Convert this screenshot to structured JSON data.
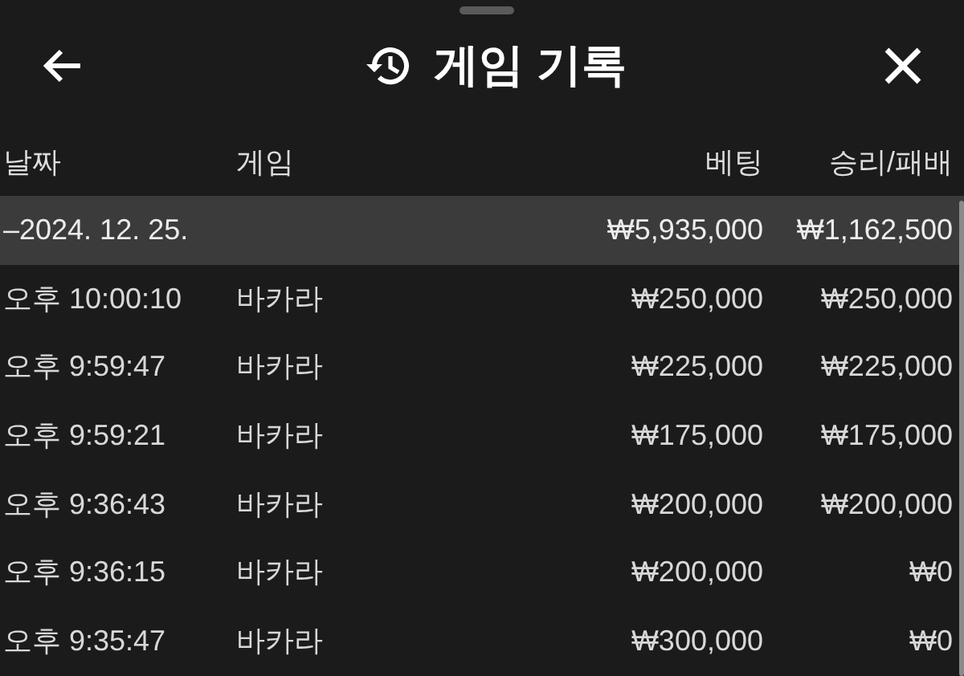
{
  "header": {
    "title": "게임 기록"
  },
  "table": {
    "columns": [
      "날짜",
      "게임",
      "베팅",
      "승리/패배"
    ],
    "group": {
      "date": "–2024. 12. 25.",
      "bet": "₩5,935,000",
      "result": "₩1,162,500"
    },
    "rows": [
      {
        "time": "오후 10:00:10",
        "game": "바카라",
        "bet": "₩250,000",
        "result": "₩250,000"
      },
      {
        "time": "오후 9:59:47",
        "game": "바카라",
        "bet": "₩225,000",
        "result": "₩225,000"
      },
      {
        "time": "오후 9:59:21",
        "game": "바카라",
        "bet": "₩175,000",
        "result": "₩175,000"
      },
      {
        "time": "오후 9:36:43",
        "game": "바카라",
        "bet": "₩200,000",
        "result": "₩200,000"
      },
      {
        "time": "오후 9:36:15",
        "game": "바카라",
        "bet": "₩200,000",
        "result": "₩0"
      },
      {
        "time": "오후 9:35:47",
        "game": "바카라",
        "bet": "₩300,000",
        "result": "₩0"
      }
    ]
  }
}
